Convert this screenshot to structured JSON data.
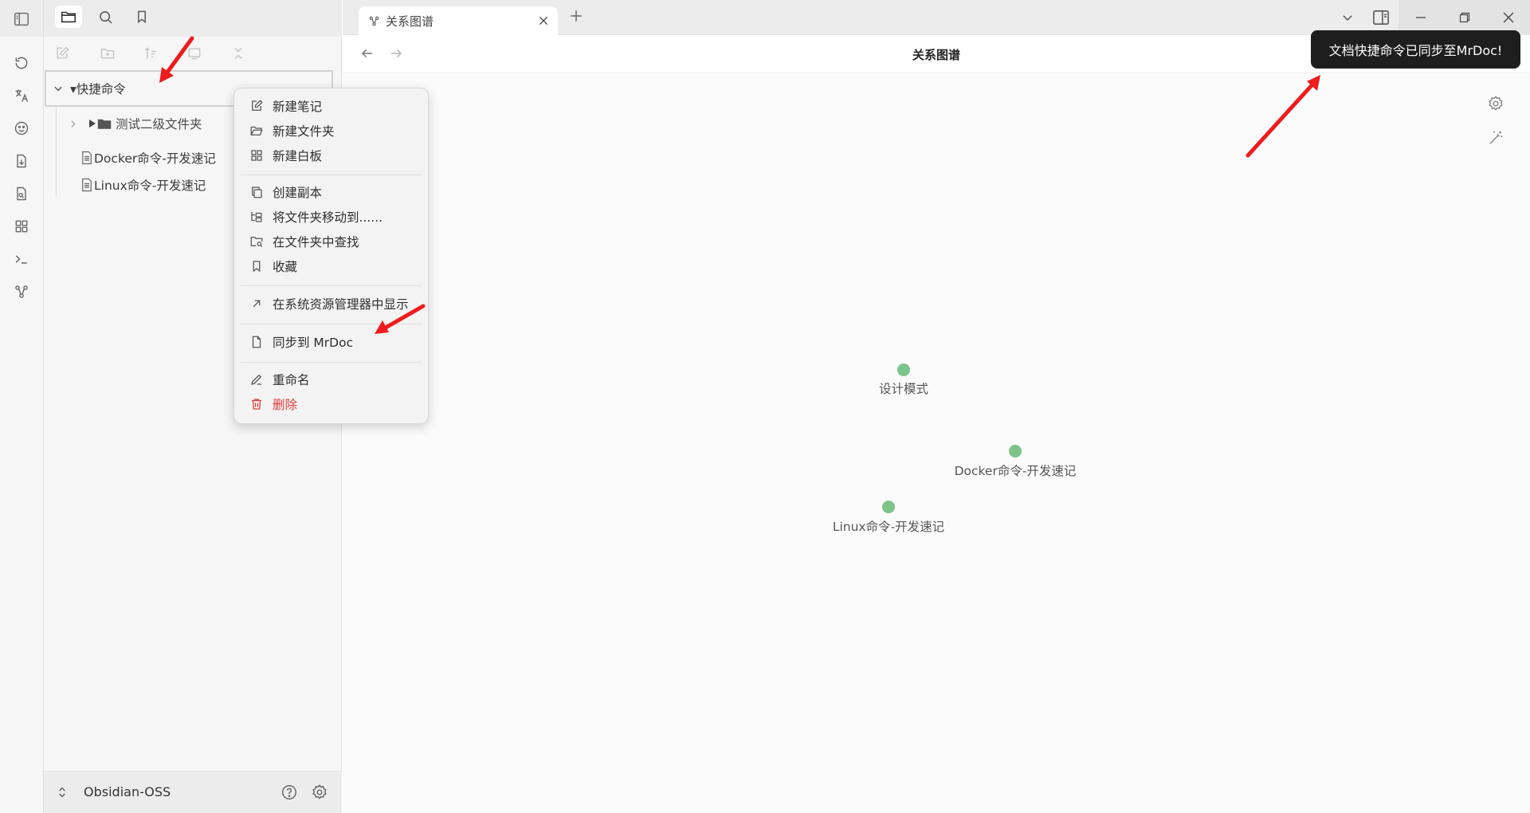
{
  "sidebar": {
    "root_folder": "▾快捷命令",
    "subfolder": "测试二级文件夹",
    "files": [
      "Docker命令-开发速记",
      "Linux命令-开发速记"
    ],
    "vault_name": "Obsidian-OSS"
  },
  "tabs": [
    {
      "label": "关系图谱",
      "icon": "graph-icon"
    }
  ],
  "view": {
    "title": "关系图谱"
  },
  "graph": {
    "nodes": [
      {
        "label": "设计模式"
      },
      {
        "label": "Docker命令-开发速记"
      },
      {
        "label": "Linux命令-开发速记"
      }
    ],
    "node_color": "#7cc48a"
  },
  "context_menu": {
    "groups": [
      [
        {
          "label": "新建笔记",
          "icon": "edit-icon"
        },
        {
          "label": "新建文件夹",
          "icon": "folder-open-icon"
        },
        {
          "label": "新建白板",
          "icon": "layout-grid-icon"
        }
      ],
      [
        {
          "label": "创建副本",
          "icon": "copy-icon"
        },
        {
          "label": "将文件夹移动到......",
          "icon": "folder-tree-icon"
        },
        {
          "label": "在文件夹中查找",
          "icon": "folder-search-icon"
        },
        {
          "label": "收藏",
          "icon": "bookmark-icon"
        }
      ],
      [
        {
          "label": "在系统资源管理器中显示",
          "icon": "arrow-up-right-icon"
        }
      ],
      [
        {
          "label": "同步到 MrDoc",
          "icon": "file-icon"
        }
      ],
      [
        {
          "label": "重命名",
          "icon": "pencil-icon"
        },
        {
          "label": "删除",
          "icon": "trash-icon",
          "danger": true
        }
      ]
    ]
  },
  "notice": {
    "text": "文档快捷命令已同步至MrDoc!"
  },
  "colors": {
    "accent_node": "#7cc48a",
    "danger": "#e03b3b",
    "annotation_arrow": "#ee1c1c",
    "notice_bg": "#1e1e1e"
  }
}
